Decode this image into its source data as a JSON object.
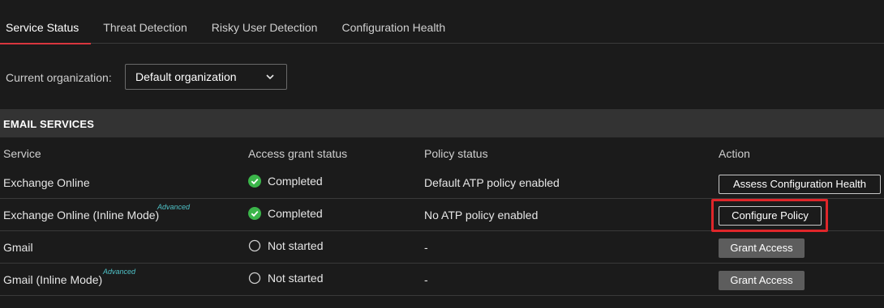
{
  "tabs": [
    {
      "label": "Service Status"
    },
    {
      "label": "Threat Detection"
    },
    {
      "label": "Risky User Detection"
    },
    {
      "label": "Configuration Health"
    }
  ],
  "org": {
    "label": "Current organization:",
    "selected": "Default organization"
  },
  "section": {
    "title": "EMAIL SERVICES"
  },
  "columns": {
    "service": "Service",
    "access": "Access grant status",
    "policy": "Policy status",
    "action": "Action"
  },
  "rows": [
    {
      "service": "Exchange Online",
      "badge": "",
      "access": "Completed",
      "access_state": "completed",
      "policy": "Default ATP policy enabled",
      "action": "Assess Configuration Health"
    },
    {
      "service": "Exchange Online (Inline Mode)",
      "badge": "Advanced",
      "access": "Completed",
      "access_state": "completed",
      "policy": "No ATP policy enabled",
      "action": "Configure Policy"
    },
    {
      "service": "Gmail",
      "badge": "",
      "access": "Not started",
      "access_state": "not-started",
      "policy": "-",
      "action": "Grant Access"
    },
    {
      "service": "Gmail (Inline Mode)",
      "badge": "Advanced",
      "access": "Not started",
      "access_state": "not-started",
      "policy": "-",
      "action": "Grant Access"
    }
  ],
  "colors": {
    "accent": "#d9363e",
    "success": "#3bb54a",
    "advanced": "#4fc3c8",
    "highlight": "#e0262a"
  }
}
